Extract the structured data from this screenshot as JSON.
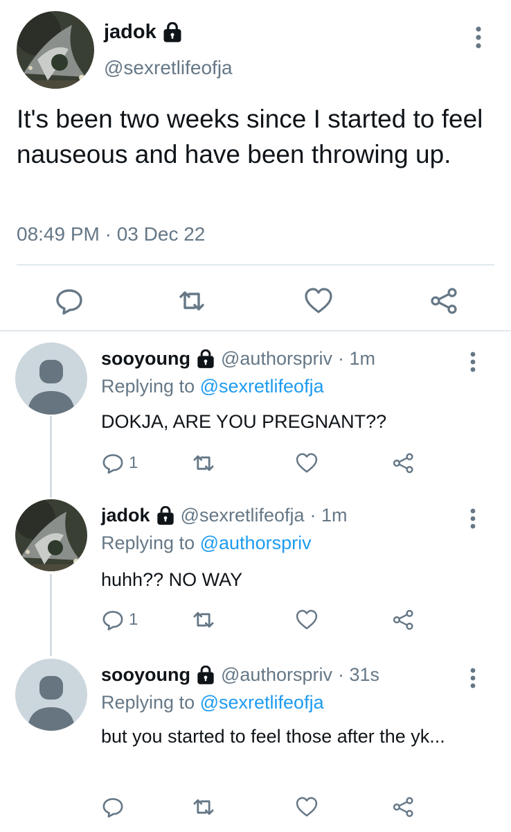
{
  "main_tweet": {
    "author_name": "jadok",
    "author_handle": "@sexretlifeofja",
    "text": "It's been two weeks since I started to feel nauseous and have been throwing up.",
    "timestamp": "08:49 PM · 03 Dec 22",
    "icons": [
      "lock-icon",
      "more-icon",
      "reply-icon",
      "retweet-icon",
      "like-icon",
      "share-icon"
    ]
  },
  "replies": [
    {
      "author_name": "sooyoung",
      "author_handle": "@authorspriv",
      "time": "· 1m",
      "replying_prefix": "Replying to",
      "replying_handle": "@sexretlifeofja",
      "text": "DOKJA, ARE YOU PREGNANT??",
      "reply_count": "1",
      "avatar": "default-avatar"
    },
    {
      "author_name": "jadok",
      "author_handle": "@sexretlifeofja",
      "time": "· 1m",
      "replying_prefix": "Replying to",
      "replying_handle": "@authorspriv",
      "text": "huhh?? NO WAY",
      "reply_count": "1",
      "avatar": "photo-avatar"
    },
    {
      "author_name": "sooyoung",
      "author_handle": "@authorspriv",
      "time": "· 31s",
      "replying_prefix": "Replying to",
      "replying_handle": "@sexretlifeofja",
      "text": "but you started to feel those after the yk...",
      "reply_count": "",
      "avatar": "default-avatar"
    }
  ],
  "colors": {
    "text": "#0f1419",
    "secondary": "#657786",
    "link": "#1d9bf0",
    "divider": "#e1e8ed",
    "default_avatar_bg": "#ccd6dd",
    "default_avatar_fg": "#66757f"
  }
}
